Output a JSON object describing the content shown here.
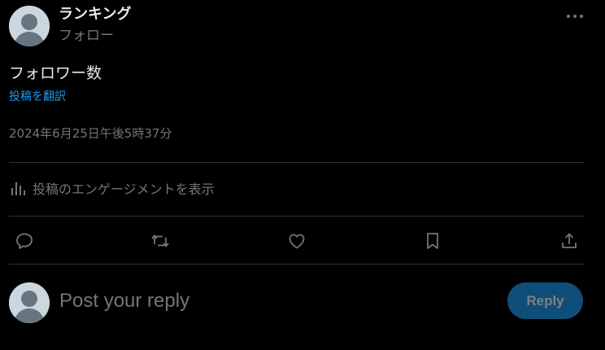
{
  "author": {
    "display_name": "ランキング",
    "follow_label": "フォロー"
  },
  "tweet": {
    "text": "フォロワー数",
    "translate_label": "投稿を翻訳",
    "timestamp": "2024年6月25日午後5時37分"
  },
  "engagement": {
    "label": "投稿のエンゲージメントを表示",
    "icon": "analytics-icon"
  },
  "actions": [
    "reply-icon",
    "retweet-icon",
    "like-icon",
    "bookmark-icon",
    "share-icon"
  ],
  "reply_composer": {
    "placeholder": "Post your reply",
    "button_label": "Reply"
  },
  "colors": {
    "background": "#000000",
    "text_primary": "#e7e9ea",
    "text_secondary": "#71767b",
    "link": "#1d9bf0",
    "reply_button_bg": "#0f4e78",
    "divider": "#2f3336"
  }
}
